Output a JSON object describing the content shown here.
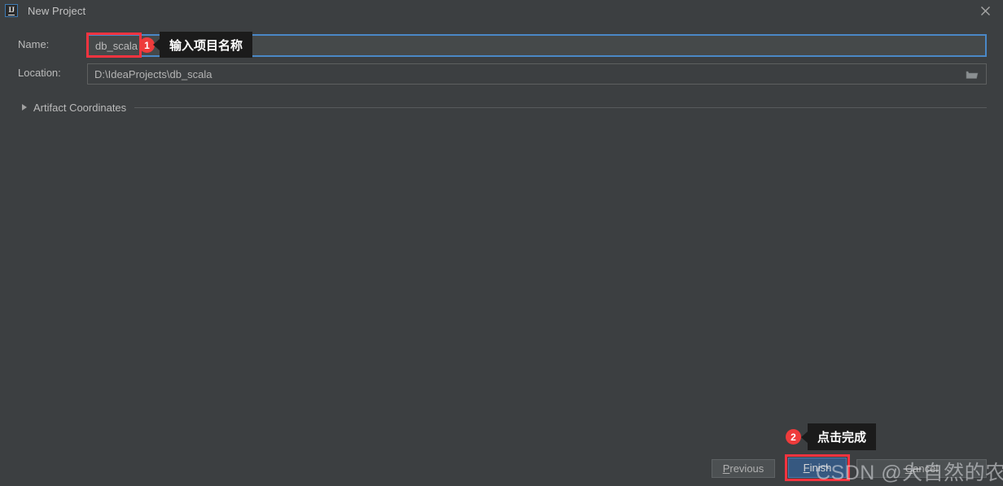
{
  "window": {
    "title": "New Project",
    "app_icon": "intellij-idea-icon",
    "close_icon": "close-icon",
    "background_color": "#3c3f41",
    "accent_color": "#4a88c7",
    "annotation_color": "#f5333f"
  },
  "form": {
    "name": {
      "label": "Name:",
      "value": "db_scala",
      "placeholder": ""
    },
    "location": {
      "label": "Location:",
      "value": "D:\\IdeaProjects\\db_scala",
      "placeholder": "",
      "browse_icon": "folder-icon"
    },
    "artifact_coordinates": {
      "label": "Artifact Coordinates",
      "expanded": false,
      "toggle_icon": "chevron-right-icon"
    }
  },
  "annotations": [
    {
      "badge": "1",
      "tooltip": "输入项目名称",
      "target": "name-input"
    },
    {
      "badge": "2",
      "tooltip": "点击完成",
      "target": "finish-button"
    }
  ],
  "buttons": {
    "previous": {
      "label": "Previous",
      "mnemonic": "P",
      "rest": "revious"
    },
    "finish": {
      "label": "Finish",
      "mnemonic": "F",
      "rest": "inish"
    },
    "cancel": {
      "label": "Cancel",
      "mnemonic": "C",
      "rest": "ancel"
    }
  },
  "watermark": {
    "text": "CSDN @大自然的农民工"
  }
}
